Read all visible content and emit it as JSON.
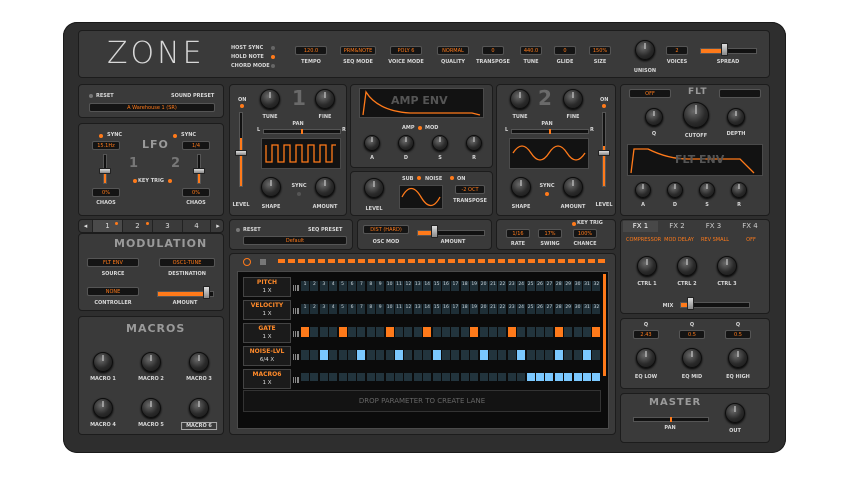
{
  "header": {
    "logo": "ZONE",
    "toggles": [
      "HOST SYNC",
      "HOLD NOTE",
      "CHORD MODE"
    ],
    "params": [
      {
        "value": "120.0",
        "label": "TEMPO"
      },
      {
        "value": "PRM&NOTE",
        "label": "SEQ MODE"
      },
      {
        "value": "POLY 6",
        "label": "VOICE MODE"
      },
      {
        "value": "NORMAL",
        "label": "QUALITY"
      },
      {
        "value": "0",
        "label": "TRANSPOSE"
      },
      {
        "value": "440.0",
        "label": "TUNE"
      },
      {
        "value": "0",
        "label": "GLIDE"
      },
      {
        "value": "150%",
        "label": "SIZE"
      }
    ],
    "unison_label": "UNISON",
    "voices_value": "2",
    "voices_label": "VOICES",
    "spread_label": "SPREAD"
  },
  "preset": {
    "reset": "RESET",
    "label": "SOUND PRESET",
    "value": "A Warehouse 1 (SR)"
  },
  "lfo": {
    "title": "LFO",
    "sync1": "SYNC",
    "rate1": "15.1Hz",
    "sync2": "SYNC",
    "rate2": "1/4",
    "num1": "1",
    "num2": "2",
    "key_trig": "KEY TRIG",
    "chaos1_value": "0%",
    "chaos1_label": "CHAOS",
    "chaos2_value": "0%",
    "chaos2_label": "CHAOS"
  },
  "osc1": {
    "num": "1",
    "on": "ON",
    "tune": "TUNE",
    "fine": "FINE",
    "pan": "PAN",
    "pan_l": "L",
    "pan_r": "R",
    "level": "LEVEL",
    "shape": "SHAPE",
    "sync": "SYNC",
    "amount": "AMOUNT"
  },
  "osc2": {
    "num": "2",
    "on": "ON",
    "tune": "TUNE",
    "fine": "FINE",
    "pan": "PAN",
    "pan_l": "L",
    "pan_r": "R",
    "level": "LEVEL",
    "shape": "SHAPE",
    "sync": "SYNC",
    "amount": "AMOUNT"
  },
  "amp_env": {
    "title": "AMP ENV",
    "amp": "AMP",
    "mod": "MOD",
    "knobs": [
      "A",
      "D",
      "S",
      "R"
    ]
  },
  "sub": {
    "level": "LEVEL",
    "sub": "SUB",
    "noise": "NOISE",
    "on": "ON",
    "transpose_value": "-2 OCT",
    "transpose_label": "TRANSPOSE"
  },
  "filter": {
    "off": "OFF",
    "title": "FLT",
    "q": "Q",
    "cutoff": "CUTOFF",
    "depth": "DEPTH",
    "env_title": "FLT ENV",
    "knobs": [
      "A",
      "D",
      "S",
      "R"
    ]
  },
  "seq_tabs": {
    "tabs": [
      "1",
      "2",
      "3",
      "4"
    ],
    "left_arrow": "◂",
    "right_arrow": "▸"
  },
  "modulation": {
    "title": "MODULATION",
    "source_value": "FLT ENV",
    "source_label": "SOURCE",
    "dest_value": "OSC1-TUNE",
    "dest_label": "DESTINATION",
    "controller_value": "NONE",
    "controller_label": "CONTROLLER",
    "amount_label": "AMOUNT"
  },
  "seq_preset": {
    "reset": "RESET",
    "label": "SEQ PRESET",
    "value": "Default"
  },
  "osc_mod": {
    "value": "DIST (HARD)",
    "label": "OSC MOD",
    "amount": "AMOUNT"
  },
  "seq_settings": {
    "key_trig": "KEY TRIG",
    "rate_value": "1/16",
    "rate_label": "RATE",
    "swing_value": "17%",
    "swing_label": "SWING",
    "chance_value": "100%",
    "chance_label": "CHANCE"
  },
  "sequencer": {
    "drop_text": "DROP PARAMETER TO CREATE LANE",
    "lanes": [
      {
        "name": "PITCH",
        "mult": "1 X",
        "kind": "pitch",
        "active": []
      },
      {
        "name": "VELOCITY",
        "mult": "1 X",
        "kind": "velocity",
        "active": []
      },
      {
        "name": "GATE",
        "mult": "1 X",
        "kind": "gate",
        "active": [
          1,
          5,
          10,
          14,
          19,
          23,
          28,
          32
        ]
      },
      {
        "name": "NOISE-LVL",
        "mult": "6/4 X",
        "kind": "noise",
        "active": [
          3,
          7,
          11,
          15,
          20,
          24,
          28,
          31
        ]
      },
      {
        "name": "MACRO6",
        "mult": "1 X",
        "kind": "macro",
        "active": [
          25,
          26,
          27,
          28,
          29,
          30,
          31,
          32
        ]
      }
    ],
    "steps": [
      "1",
      "2",
      "3",
      "4",
      "5",
      "6",
      "7",
      "8",
      "9",
      "10",
      "11",
      "12",
      "13",
      "14",
      "15",
      "16",
      "17",
      "18",
      "19",
      "20",
      "21",
      "22",
      "23",
      "24",
      "25",
      "26",
      "27",
      "28",
      "29",
      "30",
      "31",
      "32"
    ]
  },
  "macros": {
    "title": "MACROS",
    "labels": [
      "MACRO 1",
      "MACRO 2",
      "MACRO 3",
      "MACRO 4",
      "MACRO 5",
      "MACRO 6"
    ]
  },
  "fx": {
    "tabs": [
      "FX 1",
      "FX 2",
      "FX 3",
      "FX 4"
    ],
    "slots": [
      "COMPRESSOR",
      "MOD DELAY",
      "REV SMALL",
      "OFF"
    ],
    "ctrls": [
      "CTRL 1",
      "CTRL 2",
      "CTRL 3"
    ],
    "mix": "MIX"
  },
  "eq": {
    "q_label": "Q",
    "q_values": [
      "2.43",
      "0.5",
      "0.5"
    ],
    "bands": [
      "EQ LOW",
      "EQ MID",
      "EQ HIGH"
    ]
  },
  "master": {
    "title": "MASTER",
    "pan": "PAN",
    "out": "OUT"
  },
  "colors": {
    "accent": "#ff7a1a",
    "panel": "#3a3a3a",
    "chassis": "#2e2e2e",
    "step_blue": "#7ac8ff"
  }
}
